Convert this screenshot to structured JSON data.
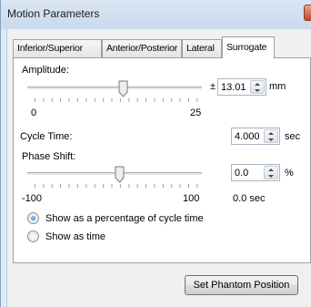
{
  "window": {
    "title": "Motion Parameters"
  },
  "tabs": [
    {
      "label": "Inferior/Superior"
    },
    {
      "label": "Anterior/Posterior"
    },
    {
      "label": "Lateral"
    },
    {
      "label": "Surrogate",
      "active": true
    }
  ],
  "amplitude": {
    "label": "Amplitude:",
    "prefix": "±",
    "value": "13.01",
    "unit": "mm",
    "min_label": "0",
    "max_label": "25",
    "slider_fraction": 0.52
  },
  "cycle_time": {
    "label": "Cycle Time:",
    "value": "4.000",
    "unit": "sec"
  },
  "phase_shift": {
    "label": "Phase Shift:",
    "value": "0.0",
    "unit": "%",
    "min_label": "-100",
    "max_label": "100",
    "seconds_readout": "0.0 sec",
    "slider_fraction": 0.5
  },
  "display_options": [
    {
      "label": "Show as a percentage of cycle time",
      "selected": true
    },
    {
      "label": "Show as time",
      "selected": false
    }
  ],
  "buttons": {
    "set_phantom_position": "Set Phantom Position"
  }
}
